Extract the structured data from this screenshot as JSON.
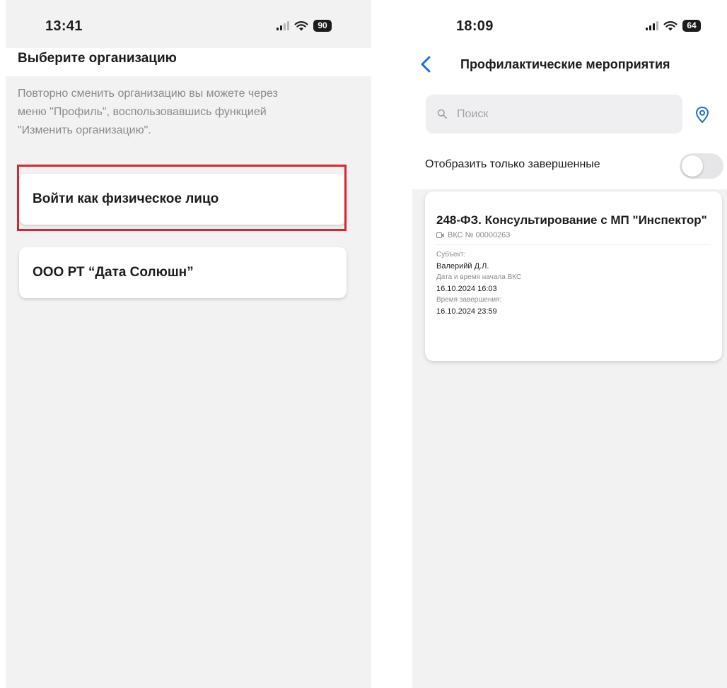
{
  "left_screen": {
    "status_bar": {
      "time": "13:41",
      "battery": "90",
      "signal_bars_active": 2
    },
    "title": "Выберите организацию",
    "hint": "Повторно сменить организацию вы можете через\nменю \"Профиль\", воспользовавшись функцией\n\"Изменить организацию\".",
    "organizations": [
      {
        "label": "Войти как физическое лицо",
        "highlighted": true
      },
      {
        "label": "ООО РТ “Дата Солюшн”",
        "highlighted": false
      }
    ]
  },
  "right_screen": {
    "status_bar": {
      "time": "18:09",
      "battery": "64",
      "signal_bars_active": 3
    },
    "title": "Профилактические мероприятия",
    "search": {
      "placeholder": "Поиск",
      "value": ""
    },
    "filter": {
      "label": "Отобразить только завершенные",
      "enabled": false
    },
    "event": {
      "title": "248-ФЗ. Консультирование с МП \"Инспектор\"",
      "vks": "ВКС № 00000263",
      "subject_label": "Субъект:",
      "subject_value": "Валерийй Д.Л.",
      "start_label": "Дата и время начала ВКС",
      "start_value": "16.10.2024 16:03",
      "end_label": "Время завершения:",
      "end_value": "16.10.2024 23:59"
    }
  },
  "colors": {
    "accent": "#1c6fd3",
    "highlight": "#d9252d",
    "background": "#f2f2f2",
    "hint_text": "#8a8a8e"
  }
}
